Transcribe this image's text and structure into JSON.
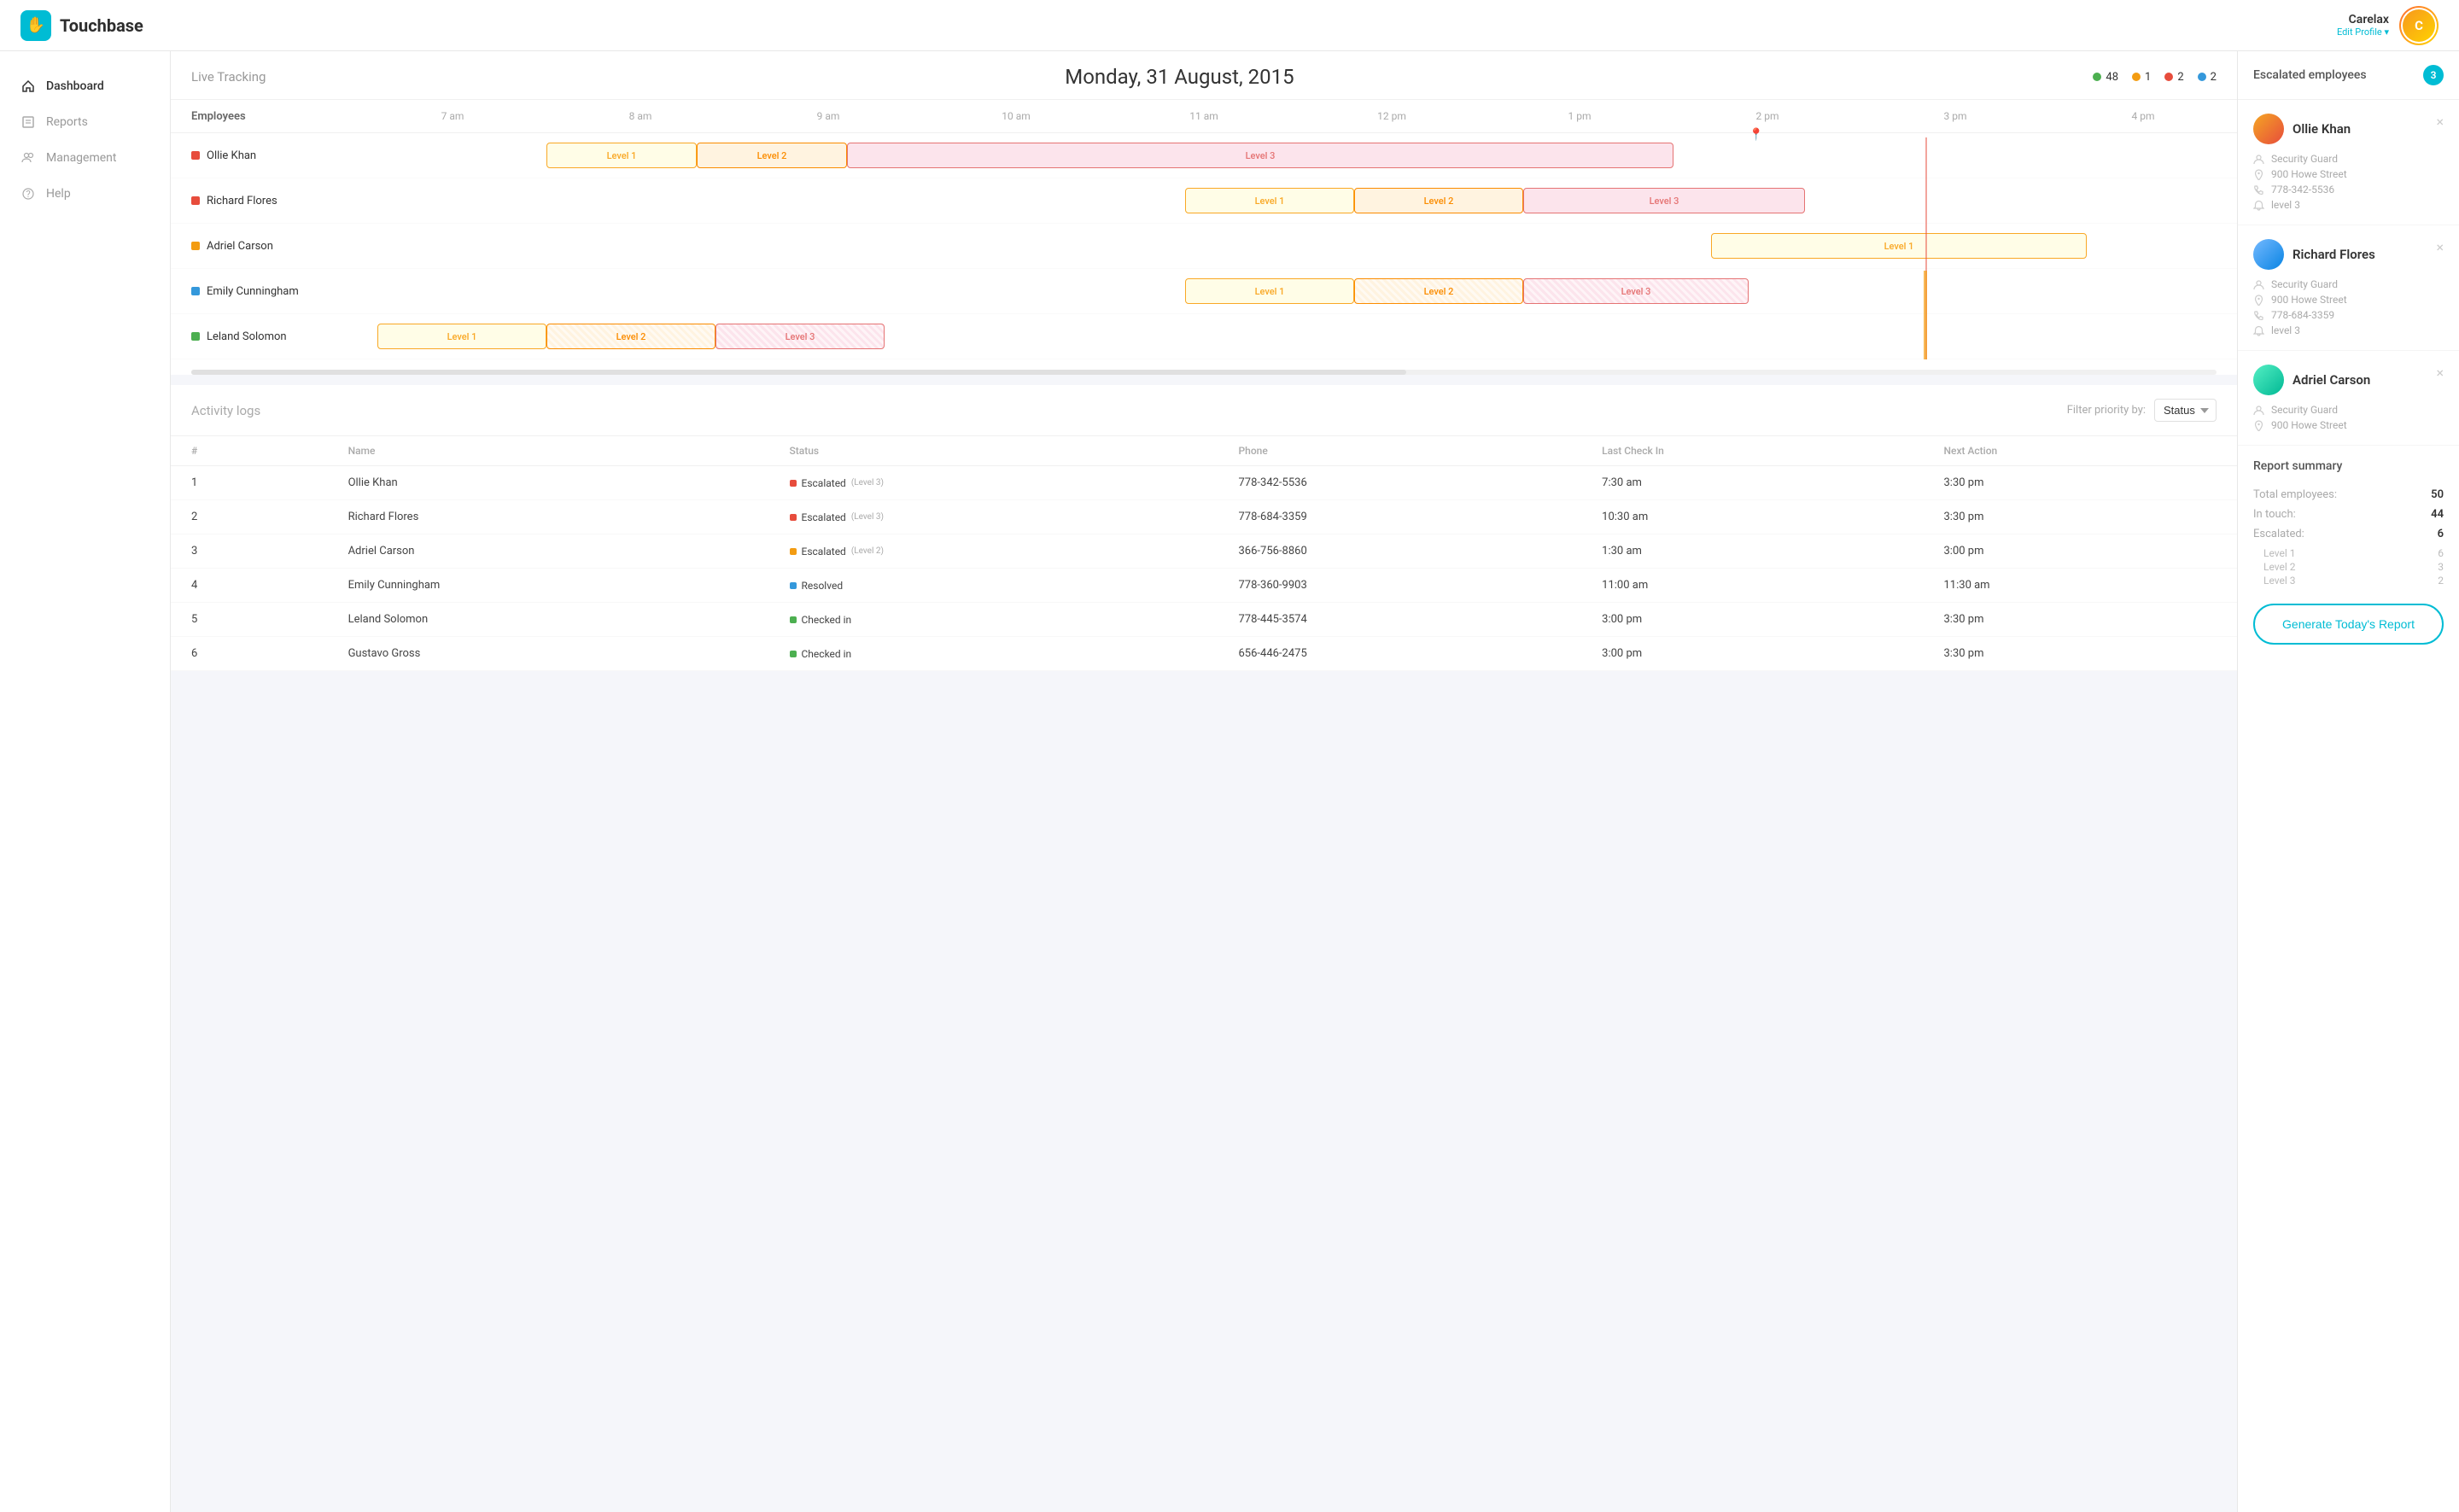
{
  "app": {
    "name": "Touchbase"
  },
  "topbar": {
    "user_name": "Carelax",
    "user_edit": "Edit Profile ▾"
  },
  "sidebar": {
    "items": [
      {
        "id": "dashboard",
        "label": "Dashboard",
        "active": true
      },
      {
        "id": "reports",
        "label": "Reports",
        "active": false
      },
      {
        "id": "management",
        "label": "Management",
        "active": false
      },
      {
        "id": "help",
        "label": "Help",
        "active": false
      }
    ]
  },
  "live_tracking": {
    "title": "Live Tracking",
    "date": "Monday, 31 August, 2015",
    "stats": [
      {
        "color": "#4caf50",
        "count": "48"
      },
      {
        "color": "#f39c12",
        "count": "1"
      },
      {
        "color": "#e74c3c",
        "count": "2"
      },
      {
        "color": "#3498db",
        "count": "2"
      }
    ],
    "time_labels": [
      "7 am",
      "8 am",
      "9 am",
      "10 am",
      "11 am",
      "12 pm",
      "1 pm",
      "2 pm",
      "3 pm",
      "4 pm"
    ],
    "employees": [
      {
        "id": "ollie",
        "name": "Ollie Khan",
        "color": "#e74c3c"
      },
      {
        "id": "richard",
        "name": "Richard Flores",
        "color": "#e74c3c"
      },
      {
        "id": "adriel",
        "name": "Adriel Carson",
        "color": "#f39c12"
      },
      {
        "id": "emily",
        "name": "Emily Cunningham",
        "color": "#3498db"
      },
      {
        "id": "leland",
        "name": "Leland Solomon",
        "color": "#4caf50"
      }
    ]
  },
  "activity_logs": {
    "title": "Activity logs",
    "filter_label": "Filter priority by:",
    "filter_value": "Status",
    "columns": [
      "#",
      "Name",
      "Status",
      "Phone",
      "Last Check In",
      "Next Action"
    ],
    "rows": [
      {
        "num": "1",
        "name": "Ollie Khan",
        "status": "Escalated",
        "status_color": "#e74c3c",
        "level": "(Level 3)",
        "phone": "778-342-5536",
        "last_checkin": "7:30 am",
        "next_action": "3:30 pm"
      },
      {
        "num": "2",
        "name": "Richard Flores",
        "status": "Escalated",
        "status_color": "#e74c3c",
        "level": "(Level 3)",
        "phone": "778-684-3359",
        "last_checkin": "10:30 am",
        "next_action": "3:30 pm"
      },
      {
        "num": "3",
        "name": "Adriel Carson",
        "status": "Escalated",
        "status_color": "#f39c12",
        "level": "(Level 2)",
        "phone": "366-756-8860",
        "last_checkin": "1:30 am",
        "next_action": "3:00 pm"
      },
      {
        "num": "4",
        "name": "Emily Cunningham",
        "status": "Resolved",
        "status_color": "#3498db",
        "level": "",
        "phone": "778-360-9903",
        "last_checkin": "11:00 am",
        "next_action": "11:30 am"
      },
      {
        "num": "5",
        "name": "Leland Solomon",
        "status": "Checked in",
        "status_color": "#4caf50",
        "level": "",
        "phone": "778-445-3574",
        "last_checkin": "3:00 pm",
        "next_action": "3:30 pm"
      },
      {
        "num": "6",
        "name": "Gustavo Gross",
        "status": "Checked in",
        "status_color": "#4caf50",
        "level": "",
        "phone": "656-446-2475",
        "last_checkin": "3:00 pm",
        "next_action": "3:30 pm"
      }
    ]
  },
  "escalated_panel": {
    "title": "Escalated employees",
    "count": "3",
    "employees": [
      {
        "name": "Ollie Khan",
        "role": "Security Guard",
        "address": "900 Howe Street",
        "phone": "778-342-5536",
        "level": "level 3"
      },
      {
        "name": "Richard Flores",
        "role": "Security Guard",
        "address": "900 Howe Street",
        "phone": "778-684-3359",
        "level": "level 3"
      },
      {
        "name": "Adriel Carson",
        "role": "Security Guard",
        "address": "900 Howe Street",
        "phone": "",
        "level": ""
      }
    ]
  },
  "report_summary": {
    "title": "Report summary",
    "rows": [
      {
        "label": "Total employees:",
        "value": "50"
      },
      {
        "label": "In touch:",
        "value": "44"
      },
      {
        "label": "Escalated:",
        "value": "6"
      }
    ],
    "sub_rows": [
      {
        "label": "Level 1",
        "value": "6"
      },
      {
        "label": "Level 2",
        "value": "3"
      },
      {
        "label": "Level 3",
        "value": "2"
      }
    ],
    "generate_btn": "Generate Today's Report"
  }
}
